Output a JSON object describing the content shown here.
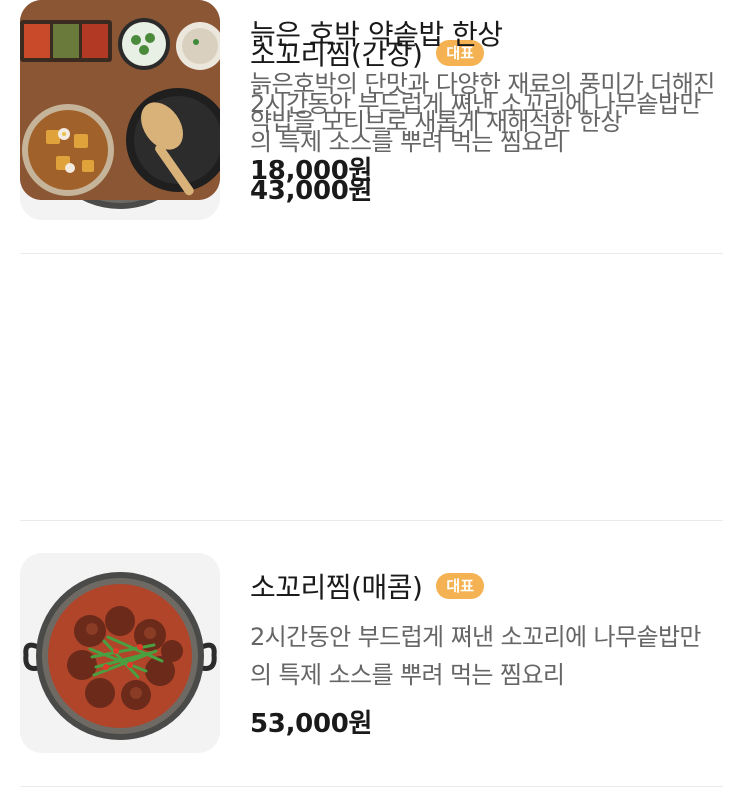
{
  "menu": {
    "items": [
      {
        "title": "소꼬리찜(간장)",
        "badge": "대표",
        "description": "2시간동안 부드럽게 쪄낸 소꼬리에 나무솥밥만의 특제 소스를 뿌려 먹는 찜요리",
        "price": "43,000원",
        "image": "braised-oxtail-soy-icon"
      },
      {
        "title": "소꼬리찜(매콤)",
        "badge": "대표",
        "description": "2시간동안 부드럽게 쪄낸 소꼬리에 나무솥밥만의 특제 소스를 뿌려 먹는 찜요리",
        "price": "53,000원",
        "image": "braised-oxtail-spicy-icon"
      },
      {
        "title": "늙은 호박 약솥밥 한상",
        "description": "늙은호박의 단맛과 다양한 재료의 풍미가 더해진 약밥을 모티브로 새롭게 재해석한 한상",
        "price": "18,000원",
        "image": "pumpkin-rice-set-icon"
      }
    ]
  },
  "colors": {
    "badge": "#f4b252",
    "title": "#1a1a1a",
    "description": "#666666",
    "divider": "#ebebeb"
  }
}
